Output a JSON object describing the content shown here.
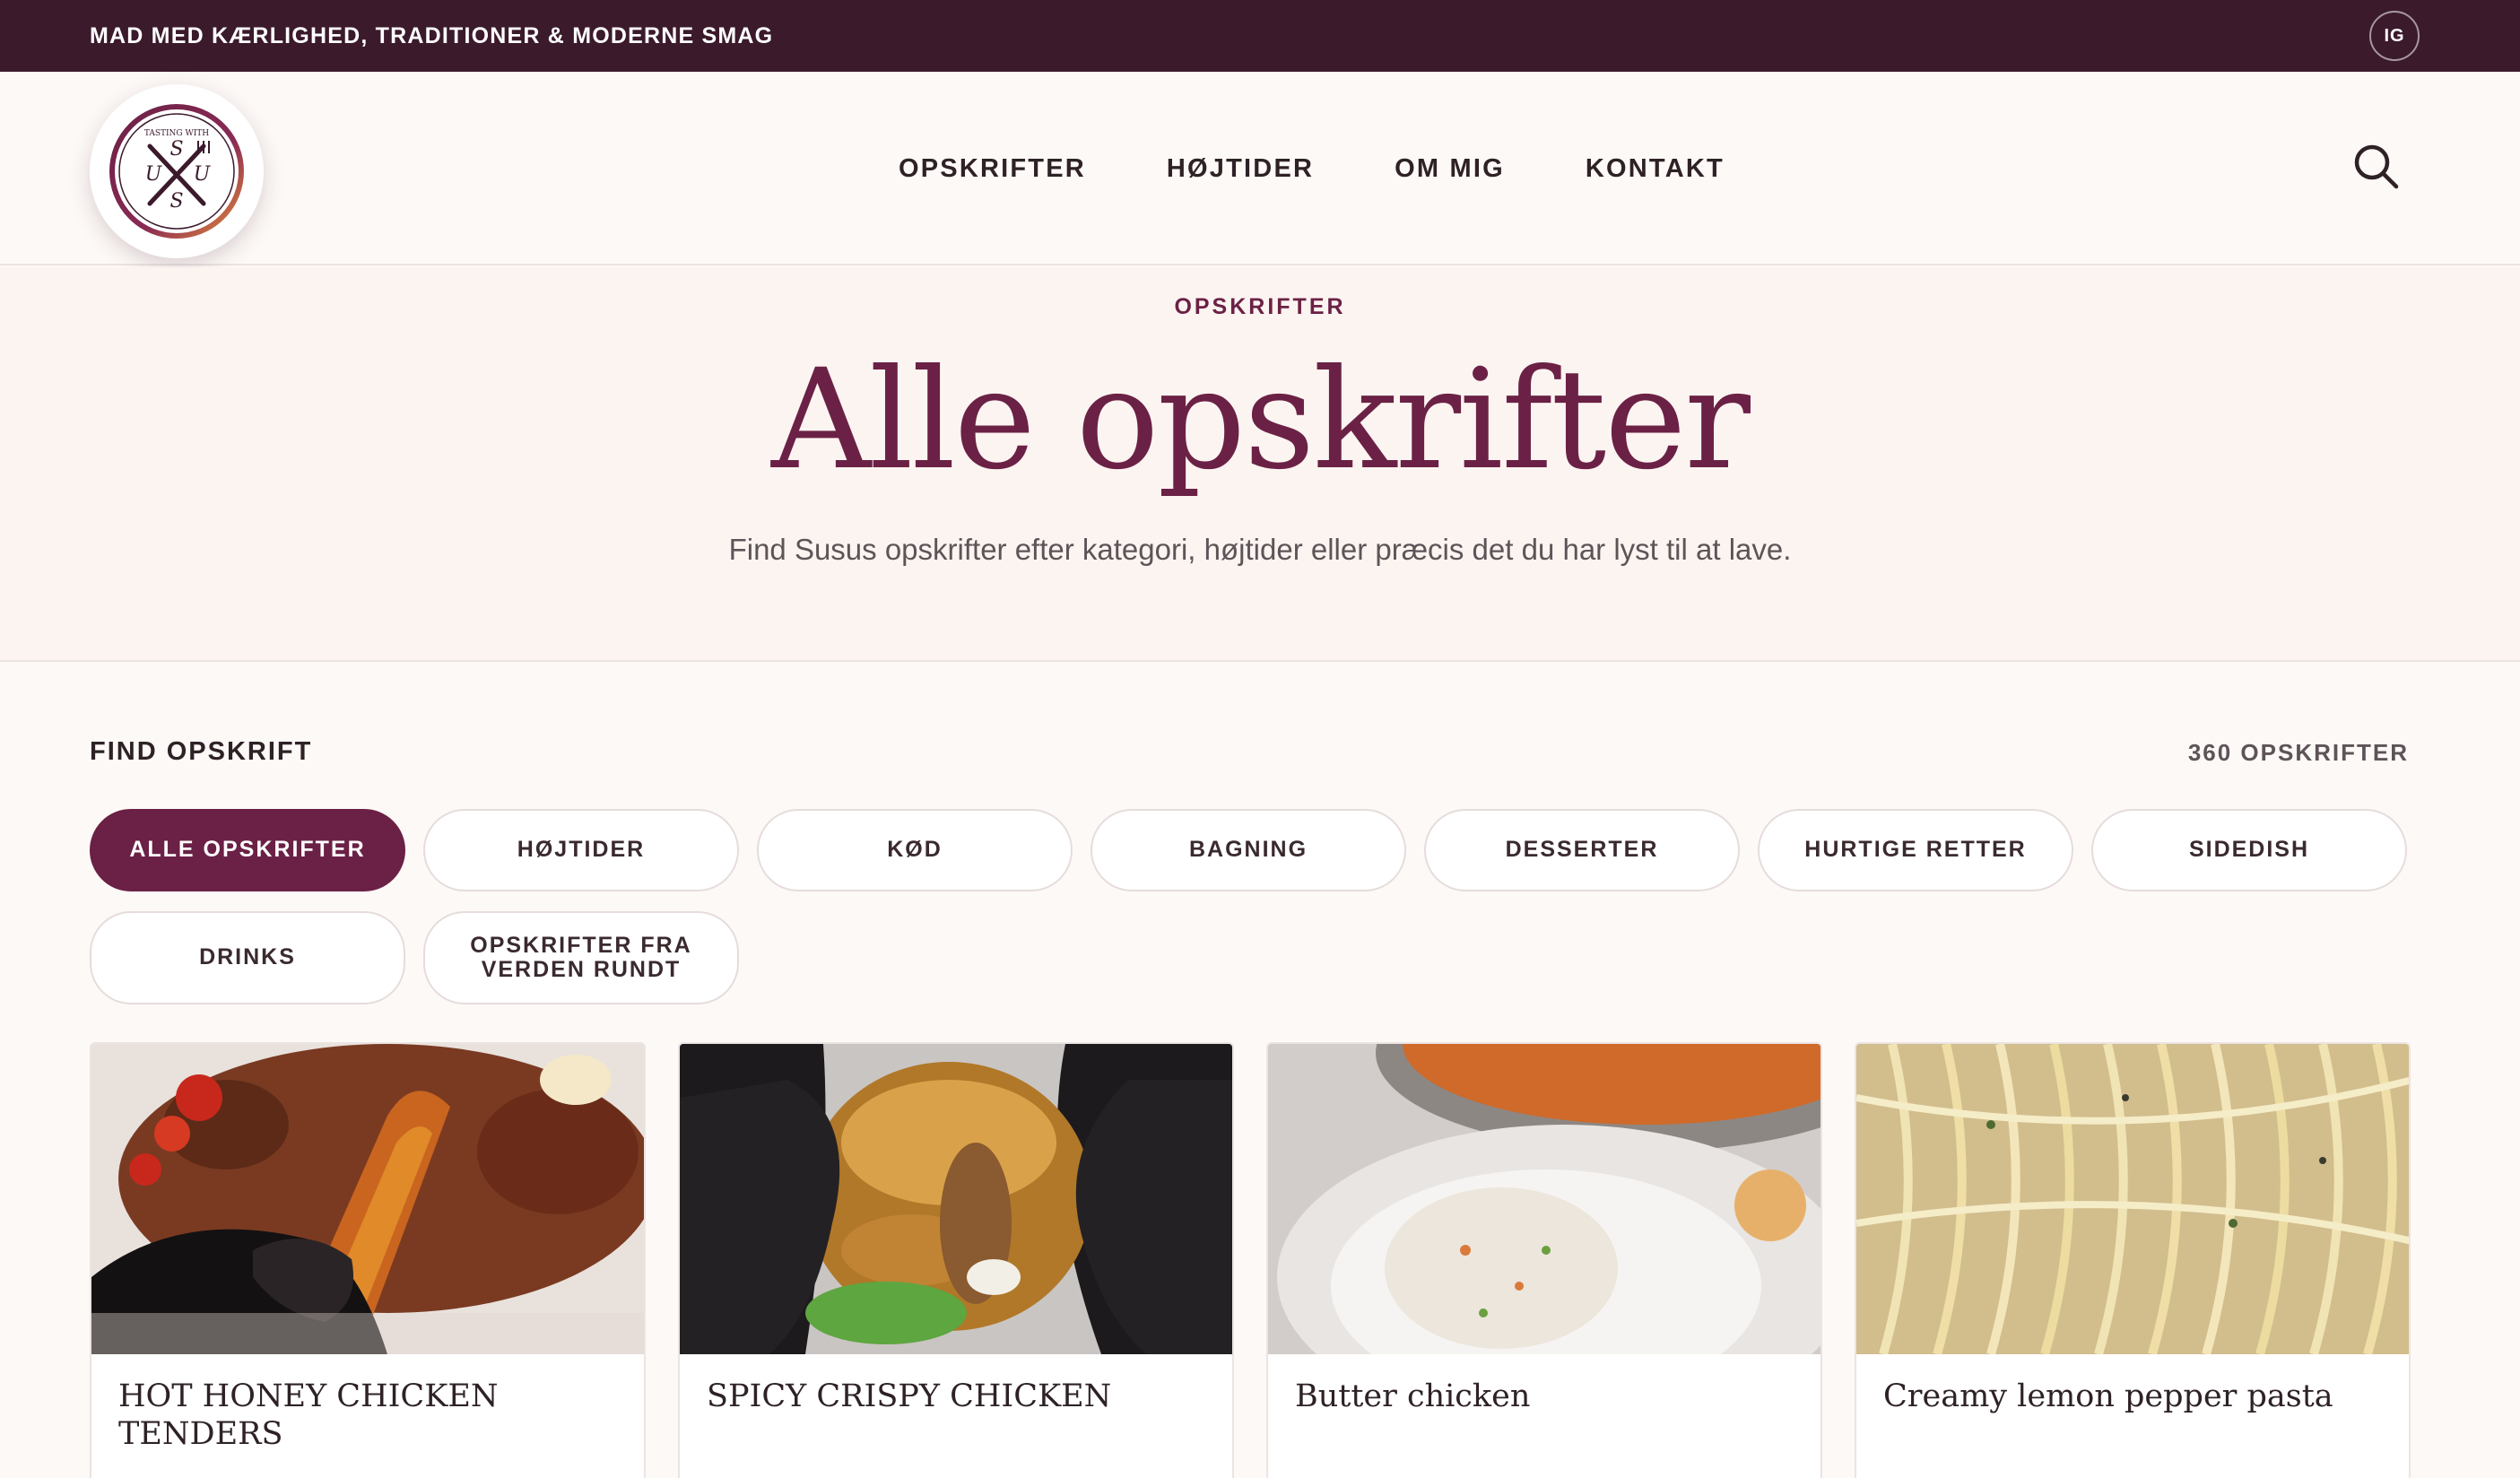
{
  "topbar": {
    "tagline": "MAD MED KÆRLIGHED, TRADITIONER & MODERNE SMAG",
    "instagram_label": "IG"
  },
  "logo": {
    "top_text": "TASTING WITH",
    "letters": [
      "S",
      "U",
      "S",
      "U"
    ]
  },
  "nav": {
    "items": [
      {
        "label": "OPSKRIFTER"
      },
      {
        "label": "HØJTIDER"
      },
      {
        "label": "OM MIG"
      },
      {
        "label": "KONTAKT"
      }
    ],
    "search_icon": "search-icon"
  },
  "hero": {
    "eyebrow": "OPSKRIFTER",
    "title": "Alle opskrifter",
    "subtitle": "Find Susus opskrifter efter kategori, højtider eller præcis det du har lyst til at lave."
  },
  "filters": {
    "label": "FIND OPSKRIFT",
    "count": "360 OPSKRIFTER",
    "chips": [
      {
        "label": "ALLE OPSKRIFTER",
        "active": true
      },
      {
        "label": "HØJTIDER",
        "active": false
      },
      {
        "label": "KØD",
        "active": false
      },
      {
        "label": "BAGNING",
        "active": false
      },
      {
        "label": "DESSERTER",
        "active": false
      },
      {
        "label": "HURTIGE RETTER",
        "active": false
      },
      {
        "label": "SIDEDISH",
        "active": false
      },
      {
        "label": "DRINKS",
        "active": false
      },
      {
        "label": "OPSKRIFTER FRA VERDEN RUNDT",
        "active": false
      }
    ]
  },
  "recipes": [
    {
      "title": "HOT HONEY CHICKEN TENDERS"
    },
    {
      "title": "SPICY CRISPY CHICKEN"
    },
    {
      "title": "Butter chicken"
    },
    {
      "title": "Creamy lemon pepper pasta"
    }
  ],
  "colors": {
    "brand": "#6b2145",
    "topbar": "#3b1a2c",
    "background": "#fdf9f7",
    "hero_background": "#fcf4f1"
  }
}
